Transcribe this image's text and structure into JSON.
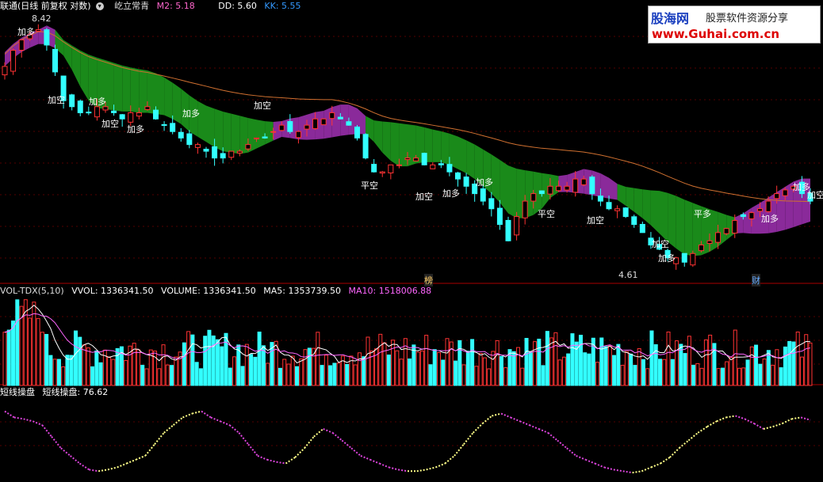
{
  "header": {
    "stock_title": "联通(日线 前复权 对数)",
    "indicator_name": "屹立常青",
    "m2": "M2: 5.18",
    "dd": "DD: 5.60",
    "kk": "KK: 5.55"
  },
  "volume_header": {
    "name": "VOL-TDX(5,10)",
    "vvol": "VVOL: 1336341.50",
    "volume": "VOLUME: 1336341.50",
    "ma5": "MA5: 1353739.50",
    "ma10": "MA10: 1518006.88"
  },
  "osc_header": {
    "name": "短线操盘",
    "value": "短线操盘: 76.62"
  },
  "logo": {
    "brand": "股海网",
    "slogan": "股票软件资源分享",
    "url": "www.Guhai.com.cn"
  },
  "colors": {
    "up": "#ff3333",
    "down": "#33ffff",
    "band_green": "#1a8a1a",
    "band_purple": "#8a2a9a",
    "ma_line": "#d07030",
    "osc_yellow": "#ffff88",
    "osc_purple": "#dd44dd",
    "header_m2": "#ff66cc",
    "header_dd": "#ffffff",
    "header_kk": "#3399ff"
  },
  "annotations": {
    "high_label": "8.42",
    "low_label": "4.61",
    "tags": [
      "加多",
      "加空",
      "加多",
      "加空",
      "加多",
      "加多",
      "加空",
      "平空",
      "加空",
      "加多",
      "加多",
      "平空",
      "加空",
      "加多",
      "加空",
      "平多",
      "加多",
      "加空",
      "加多",
      "榜",
      "财"
    ]
  },
  "chart_data": [
    {
      "type": "candlestick",
      "title": "屹立常青",
      "price_range": [
        4.61,
        8.42
      ],
      "scale": "log",
      "close": [
        7.6,
        7.9,
        8.1,
        8.2,
        8.3,
        8.0,
        7.5,
        7.0,
        6.9,
        6.8,
        6.8,
        6.9,
        6.9,
        6.8,
        6.7,
        6.8,
        6.8,
        6.9,
        6.7,
        6.6,
        6.5,
        6.4,
        6.3,
        6.3,
        6.2,
        6.1,
        6.1,
        6.2,
        6.2,
        6.3,
        6.4,
        6.4,
        6.5,
        6.6,
        6.5,
        6.5,
        6.6,
        6.7,
        6.7,
        6.8,
        6.7,
        6.6,
        6.4,
        6.1,
        5.9,
        5.9,
        6.0,
        6.0,
        6.1,
        6.1,
        6.0,
        6.0,
        6.0,
        5.9,
        5.8,
        5.7,
        5.6,
        5.5,
        5.4,
        5.2,
        5.0,
        5.3,
        5.5,
        5.6,
        5.6,
        5.7,
        5.7,
        5.7,
        5.8,
        5.8,
        5.6,
        5.5,
        5.4,
        5.4,
        5.3,
        5.2,
        5.1,
        4.95,
        4.9,
        4.8,
        4.8,
        4.75,
        4.85,
        4.95,
        5.0,
        5.1,
        5.15,
        5.25,
        5.3,
        5.35,
        5.4,
        5.5,
        5.6,
        5.65,
        5.7,
        5.6,
        5.5
      ],
      "volume_range": [
        0,
        1600000
      ]
    },
    {
      "type": "line",
      "title": "短线操盘",
      "y": [
        88,
        80,
        78,
        75,
        70,
        55,
        40,
        30,
        20,
        12,
        10,
        12,
        15,
        20,
        25,
        30,
        45,
        60,
        70,
        80,
        85,
        88,
        80,
        75,
        70,
        60,
        45,
        30,
        25,
        22,
        20,
        28,
        40,
        55,
        65,
        60,
        50,
        40,
        30,
        25,
        20,
        15,
        12,
        10,
        10,
        12,
        15,
        20,
        30,
        45,
        60,
        72,
        82,
        85,
        80,
        75,
        70,
        65,
        60,
        50,
        40,
        30,
        25,
        20,
        15,
        12,
        10,
        8,
        10,
        15,
        20,
        28,
        40,
        50,
        60,
        68,
        75,
        80,
        82,
        78,
        72,
        65,
        68,
        72,
        78,
        80,
        76.62
      ]
    }
  ]
}
